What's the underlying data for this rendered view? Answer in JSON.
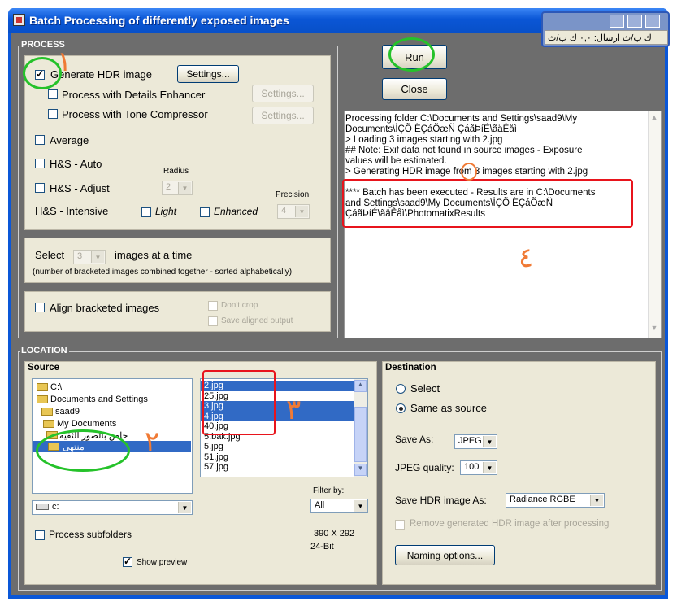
{
  "window": {
    "title": "Batch Processing of differently exposed images"
  },
  "overlay": {
    "text": "ك ب/ث  ارسال: ٠,٠ ك ب/ث"
  },
  "process": {
    "group_label": "PROCESS",
    "generate_hdr": {
      "label": "Generate HDR image",
      "checked": true
    },
    "settings_label": "Settings...",
    "details_enhancer": {
      "label": "Process with Details Enhancer",
      "checked": false
    },
    "tone_compressor": {
      "label": "Process with Tone Compressor",
      "checked": false
    },
    "average": {
      "label": "Average"
    },
    "hs_auto": {
      "label": "H&S - Auto"
    },
    "hs_adjust": {
      "label": "H&S - Adjust"
    },
    "radius": {
      "label": "Radius",
      "value": "2"
    },
    "precision": {
      "label": "Precision",
      "value": "4"
    },
    "hs_intensive": {
      "label": "H&S - Intensive"
    },
    "light": {
      "label": "Light"
    },
    "enhanced": {
      "label": "Enhanced"
    },
    "select_label": "Select",
    "select_value": "3",
    "images_at_time": "images at a time",
    "select_note": "(number of bracketed images combined together - sorted alphabetically)",
    "align": {
      "label": "Align bracketed images"
    },
    "dont_crop": {
      "label": "Don't crop"
    },
    "save_aligned": {
      "label": "Save aligned output"
    }
  },
  "actions": {
    "run": "Run",
    "close": "Close"
  },
  "log": {
    "lines": [
      "Processing folder C:\\Documents and Settings\\saad9\\My",
      "Documents\\ÎÇÕ ÈÇáÕæÑ ÇáãÞíÉ\\ãäÊåì",
      "> Loading 3 images starting with 2.jpg",
      "## Note: Exif data not found in source images - Exposure",
      "values will be estimated.",
      "> Generating HDR image from 3 images starting with 2.jpg",
      "",
      "**** Batch has been executed - Results are in C:\\Documents",
      "and Settings\\saad9\\My Documents\\ÎÇÕ ÈÇáÕæÑ",
      "ÇáãÞíÉ\\ãäÊåì\\PhotomatixResults"
    ]
  },
  "location": {
    "group_label": "LOCATION",
    "source": {
      "label": "Source",
      "folders": [
        {
          "name": "C:\\",
          "selected": false
        },
        {
          "name": "Documents and Settings",
          "selected": false
        },
        {
          "name": "saad9",
          "selected": false
        },
        {
          "name": "My Documents",
          "selected": false
        },
        {
          "name": "خاص بالصور الثقية",
          "selected": false
        },
        {
          "name": "منتهى",
          "selected": true
        }
      ],
      "files": [
        {
          "name": "2.jpg",
          "selected": true
        },
        {
          "name": "25.jpg",
          "selected": false
        },
        {
          "name": "3.jpg",
          "selected": true
        },
        {
          "name": "4.jpg",
          "selected": true
        },
        {
          "name": "40.jpg",
          "selected": false
        },
        {
          "name": "5.bak.jpg",
          "selected": false
        },
        {
          "name": "5.jpg",
          "selected": false
        },
        {
          "name": "51.jpg",
          "selected": false
        },
        {
          "name": "57.jpg",
          "selected": false
        }
      ],
      "drive": "c:",
      "filter_label": "Filter by:",
      "filter_value": "All",
      "process_subfolders": "Process subfolders",
      "show_preview": "Show preview",
      "dimensions": "390 X 292",
      "bits": "24-Bit"
    },
    "destination": {
      "label": "Destination",
      "select": "Select",
      "same_as_source": "Same as source",
      "save_as_label": "Save As:",
      "save_as_value": "JPEG",
      "quality_label": "JPEG quality:",
      "quality_value": "100",
      "save_hdr_label": "Save HDR image As:",
      "save_hdr_value": "Radiance RGBE",
      "remove_generated": "Remove generated HDR image after processing",
      "naming_options": "Naming options..."
    }
  },
  "annotations": {
    "n1": "١",
    "n2": "٢",
    "n3": "٣",
    "n4": "٤"
  },
  "colors": {
    "titlebar": "#0a56d6",
    "client": "#6d6d6d",
    "panel": "#ece9d8",
    "selection": "#316ac5",
    "highlight_red": "#e8141c",
    "highlight_green": "#25c22a",
    "annotation_orange": "#f07a35"
  }
}
